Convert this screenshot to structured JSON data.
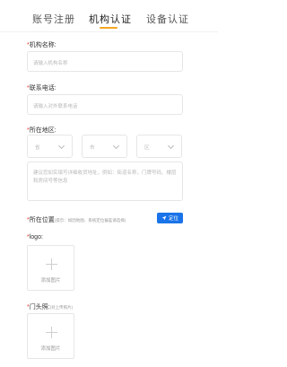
{
  "tabs": [
    {
      "label": "账号注册"
    },
    {
      "label": "机构认证"
    },
    {
      "label": "设备认证"
    }
  ],
  "form": {
    "required_mark": "*",
    "org_name": {
      "label": "机构名称:",
      "placeholder": "请输入机构名称"
    },
    "phone": {
      "label": "联系电话:",
      "placeholder": "请输入对外联系电话"
    },
    "region": {
      "label": "所在地区:",
      "province": "省",
      "city": "市",
      "district": "区"
    },
    "address_placeholder": "建议您如实填写详细收货地址，例如：街道名称，门牌号码、楼层和房间号等信息",
    "location": {
      "label": "所在位置",
      "hint": "(提示：如因地图、系统定位偏差请选择)",
      "button": "定位"
    },
    "logo": {
      "label": "logo:",
      "upload_text": "添加图片"
    },
    "storefront": {
      "label": "门头照:",
      "hint": "(对上传照片)",
      "upload_text": "添加图片"
    }
  },
  "colors": {
    "accent": "#f5a623",
    "primary_button": "#1a73e8",
    "required": "#e53935"
  }
}
